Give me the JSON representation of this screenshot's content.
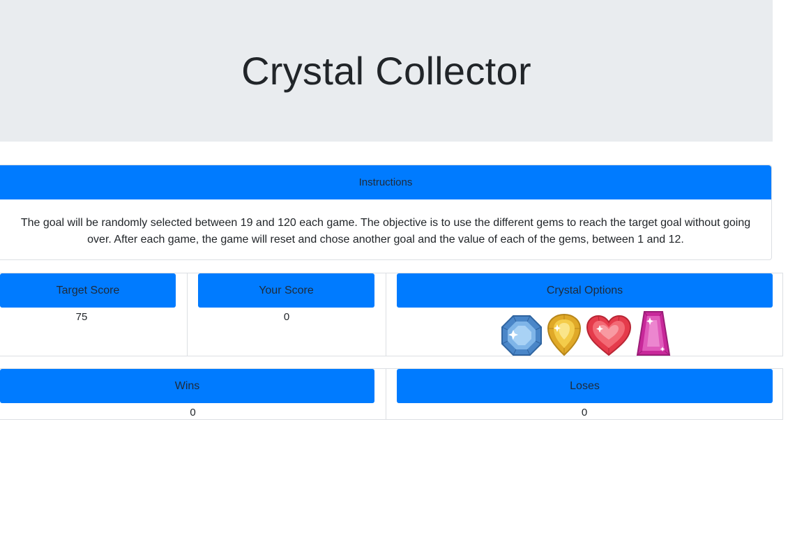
{
  "header": {
    "title": "Crystal Collector"
  },
  "instructions": {
    "title": "Instructions",
    "text": "The goal will be randomly selected between 19 and 120 each game. The objective is to use the different gems to reach the target goal without going over. After each game, the game will reset and chose another goal and the value of each of the gems, between 1 and 12."
  },
  "target": {
    "label": "Target Score",
    "value": "75"
  },
  "your_score": {
    "label": "Your Score",
    "value": "0"
  },
  "crystals": {
    "label": "Crystal Options",
    "items": [
      {
        "name": "blue-octagon-gem",
        "color": "#5b9bd8"
      },
      {
        "name": "yellow-drop-gem",
        "color": "#f0c33c"
      },
      {
        "name": "red-heart-gem",
        "color": "#f0555f"
      },
      {
        "name": "pink-trapezoid-gem",
        "color": "#d63fa8"
      }
    ]
  },
  "wins": {
    "label": "Wins",
    "value": "0"
  },
  "losses": {
    "label": "Loses",
    "value": "0"
  },
  "colors": {
    "primary": "#007bff",
    "jumbotron": "#e9ecef"
  }
}
